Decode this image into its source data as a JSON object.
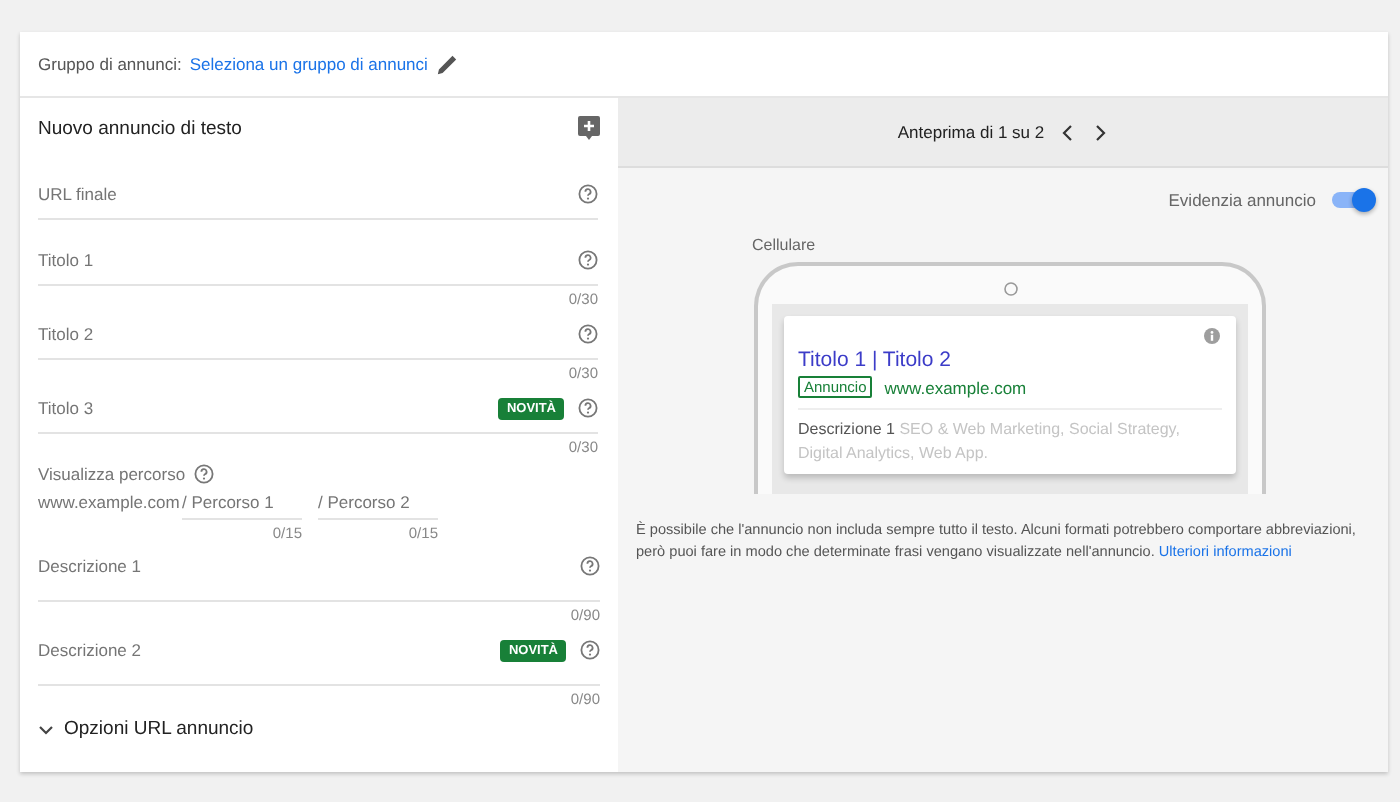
{
  "ad_group": {
    "label": "Gruppo di annunci:",
    "link": "Seleziona un gruppo di annunci"
  },
  "form": {
    "title": "Nuovo annuncio di testo",
    "fields": [
      {
        "label": "URL finale"
      },
      {
        "label": "Titolo 1",
        "counter": "0/30"
      },
      {
        "label": "Titolo 2",
        "counter": "0/30"
      },
      {
        "label": "Titolo 3",
        "badge": "NOVITÀ",
        "counter": "0/30"
      }
    ],
    "path": {
      "label": "Visualizza percorso",
      "domain": "www.example.com",
      "inputs": [
        {
          "placeholder": "/ Percorso 1",
          "counter": "0/15"
        },
        {
          "placeholder": "/ Percorso 2",
          "counter": "0/15"
        }
      ]
    },
    "descriptions": [
      {
        "label": "Descrizione 1",
        "counter": "0/90"
      },
      {
        "label": "Descrizione 2",
        "badge": "NOVITÀ",
        "counter": "0/90"
      }
    ],
    "url_options": {
      "label": "Opzioni URL annuncio",
      "expanded": false
    }
  },
  "preview": {
    "pager": "Anteprima di 1 su 2",
    "highlight": {
      "label": "Evidenzia annuncio",
      "on": true
    },
    "device": "Cellulare",
    "ad": {
      "headline": "Titolo 1 | Titolo 2",
      "badge": "Annuncio",
      "url": "www.example.com",
      "description_label": "Descrizione 1",
      "description": "SEO & Web Marketing, Social Strategy, Digital Analytics, Web App."
    },
    "note": "È possibile che l'annuncio non includa sempre tutto il testo. Alcuni formati potrebbero comportare abbreviazioni, però puoi fare in modo che determinate frasi vengano visualizzate nell'annuncio.",
    "note_link": "Ulteriori informazioni"
  }
}
